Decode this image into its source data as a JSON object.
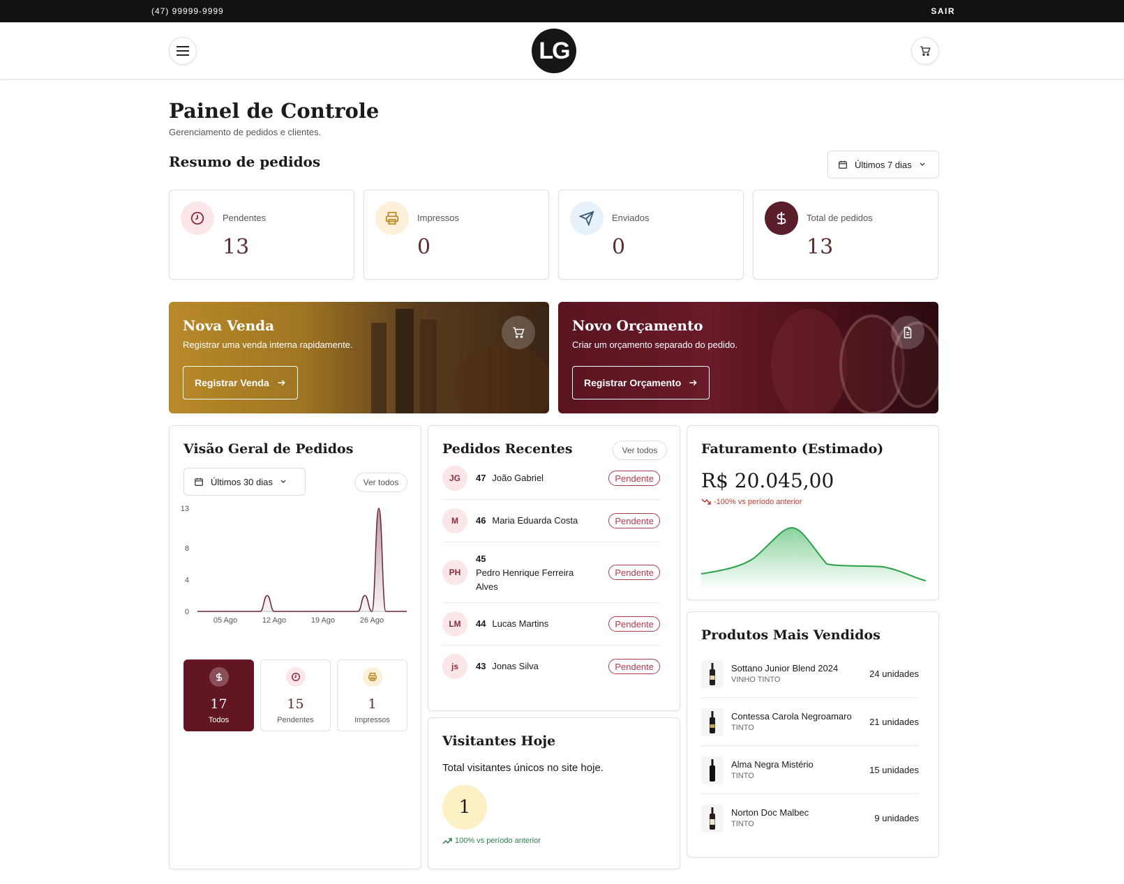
{
  "topbar": {
    "phone": "(47) 99999-9999",
    "logout": "SAIR"
  },
  "header": {
    "logo": "LG",
    "menu_icon": "menu-icon",
    "cart_icon": "cart-icon"
  },
  "page": {
    "title": "Painel de Controle",
    "subtitle": "Gerenciamento de pedidos e clientes.",
    "section_title": "Resumo de pedidos",
    "range": "Últimos 7 dias"
  },
  "stats": [
    {
      "label": "Pendentes",
      "value": "13",
      "icon": "clock-icon",
      "color": "#fbe6e8",
      "fg": "#8a2a3a"
    },
    {
      "label": "Impressos",
      "value": "0",
      "icon": "printer-icon",
      "color": "#fdf0d9",
      "fg": "#b98a2a"
    },
    {
      "label": "Enviados",
      "value": "0",
      "icon": "send-icon",
      "color": "#e6f1fa",
      "fg": "#3a5a7a"
    },
    {
      "label": "Total de pedidos",
      "value": "13",
      "icon": "dollar-icon",
      "color": "#5a1f2a",
      "fg": "#ffffff"
    }
  ],
  "banners": {
    "sale": {
      "title": "Nova Venda",
      "subtitle": "Registrar uma venda interna rapidamente.",
      "button": "Registrar Venda"
    },
    "quote": {
      "title": "Novo Orçamento",
      "subtitle": "Criar um orçamento separado do pedido.",
      "button": "Registrar Orçamento"
    }
  },
  "overview": {
    "title": "Visão Geral de Pedidos",
    "range": "Últimos 30 dias",
    "see_all": "Ver todos",
    "segments": [
      {
        "value": "17",
        "label": "Todos",
        "icon": "dollar-icon"
      },
      {
        "value": "15",
        "label": "Pendentes",
        "icon": "clock-icon"
      },
      {
        "value": "1",
        "label": "Impressos",
        "icon": "printer-icon"
      }
    ]
  },
  "chart_data": {
    "type": "area",
    "title": "",
    "xlabel": "",
    "ylabel": "",
    "y_ticks": [
      0,
      4,
      8,
      13
    ],
    "x_ticks": [
      "05 Ago",
      "12 Ago",
      "19 Ago",
      "26 Ago"
    ],
    "ylim": [
      0,
      13
    ],
    "x": [
      "01 Ago",
      "02 Ago",
      "03 Ago",
      "04 Ago",
      "05 Ago",
      "06 Ago",
      "07 Ago",
      "08 Ago",
      "09 Ago",
      "10 Ago",
      "11 Ago",
      "12 Ago",
      "13 Ago",
      "14 Ago",
      "15 Ago",
      "16 Ago",
      "17 Ago",
      "18 Ago",
      "19 Ago",
      "20 Ago",
      "21 Ago",
      "22 Ago",
      "23 Ago",
      "24 Ago",
      "25 Ago",
      "26 Ago",
      "27 Ago",
      "28 Ago",
      "29 Ago",
      "30 Ago",
      "31 Ago"
    ],
    "series": [
      {
        "values": [
          0,
          0,
          0,
          0,
          0,
          0,
          0,
          0,
          0,
          0,
          2,
          0,
          0,
          0,
          0,
          0,
          0,
          0,
          0,
          0,
          0,
          0,
          0,
          0,
          2,
          0,
          13,
          0,
          0,
          0,
          0
        ]
      }
    ],
    "grid": false,
    "color": "#6a2530"
  },
  "orders": {
    "title": "Pedidos Recentes",
    "see_all": "Ver todos",
    "items": [
      {
        "initials": "JG",
        "id": "47",
        "name": "João Gabriel",
        "status": "Pendente"
      },
      {
        "initials": "M",
        "id": "46",
        "name": "Maria Eduarda Costa",
        "status": "Pendente"
      },
      {
        "initials": "PH",
        "id": "45",
        "name": "Pedro Henrique Ferreira Alves",
        "status": "Pendente"
      },
      {
        "initials": "LM",
        "id": "44",
        "name": "Lucas Martins",
        "status": "Pendente"
      },
      {
        "initials": "js",
        "id": "43",
        "name": "Jonas Silva",
        "status": "Pendente"
      }
    ]
  },
  "visitors": {
    "title": "Visitantes Hoje",
    "subtitle": "Total visitantes únicos no site hoje.",
    "value": "1",
    "trend": "100% vs período anterior"
  },
  "revenue": {
    "title": "Faturamento (Estimado)",
    "value": "R$ 20.045,00",
    "trend": "-100% vs período anterior"
  },
  "products": {
    "title": "Produtos Mais Vendidos",
    "items": [
      {
        "name": "Sottano Junior Blend 2024",
        "type": "VINHO TINTO",
        "units": "24 unidades"
      },
      {
        "name": "Contessa Carola Negroamaro",
        "type": "TINTO",
        "units": "21 unidades"
      },
      {
        "name": "Alma Negra Mistério",
        "type": "TINTO",
        "units": "15 unidades"
      },
      {
        "name": "Norton Doc Malbec",
        "type": "TINTO",
        "units": "9 unidades"
      }
    ]
  }
}
